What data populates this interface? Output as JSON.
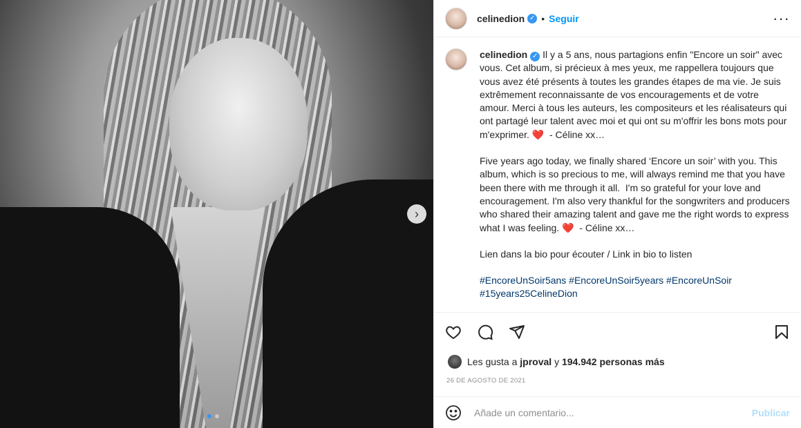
{
  "post": {
    "username": "celinedion",
    "follow_label": "Seguir",
    "separator": "•",
    "more_label": "···",
    "caption_fr": "Il y a 5 ans, nous partagions enfin \"Encore un soir\" avec vous. Cet album, si précieux à mes yeux, me rappellera toujours que vous avez été présents à toutes les grandes étapes de ma vie. Je suis extrêmement reconnaissante de vos encouragements et de votre amour. Merci à tous les auteurs, les compositeurs et les réalisateurs qui ont partagé leur talent avec moi et qui ont su m'offrir les bons mots pour m'exprimer. ❤️  - Céline xx…",
    "caption_en": "Five years ago today, we finally shared ‘Encore un soir’ with you. This album, which is so precious to me, will always remind me that you have been there with me through it all.  I'm so grateful for your love and encouragement. I'm also very thankful for the songwriters and producers who shared their amazing talent and gave me the right words to express what I was feeling. ❤️  - Céline xx…",
    "caption_link": "Lien dans la bio pour écouter / Link in bio to listen",
    "hashtags": "#EncoreUnSoir5ans #EncoreUnSoir5years #EncoreUnSoir",
    "hashtags_2": "#15years25CelineDion",
    "likes_prefix": "Les gusta a",
    "likes_user": "jproval",
    "likes_mid": "y",
    "likes_count": "194.942 personas más",
    "date": "26 de agosto de 2021",
    "comment_placeholder": "Añade un comentario...",
    "publish_label": "Publicar",
    "carousel": {
      "current": 1,
      "total": 2
    }
  },
  "icons": {
    "next": "chevron-right-icon",
    "verified": "verified-badge-icon",
    "heart": "heart-icon",
    "comment": "comment-icon",
    "share": "share-icon",
    "save": "bookmark-icon",
    "emoji": "emoji-icon"
  },
  "colors": {
    "accent": "#0095f6",
    "verified": "#3897f0",
    "hashtag": "#00376b",
    "muted": "#8e8e8e",
    "heart": "#ed4956"
  }
}
